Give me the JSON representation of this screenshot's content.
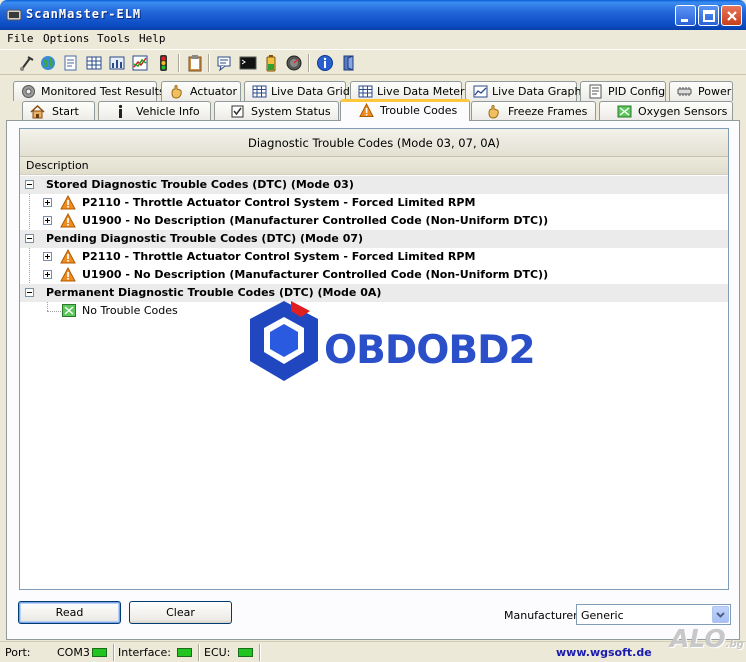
{
  "window": {
    "title": "ScanMaster-ELM"
  },
  "menu": [
    "File",
    "Options",
    "Tools",
    "Help"
  ],
  "toolbar_icons": [
    "connect-icon",
    "globe-icon",
    "document-icon",
    "grid-icon",
    "meter-icon",
    "graph-icon",
    "traffic-light-icon",
    "clipboard-icon",
    "chat-icon",
    "terminal-icon",
    "battery-icon",
    "gauge-icon",
    "info-icon",
    "exit-icon"
  ],
  "tabs_row1": [
    {
      "label": "Monitored Test Results",
      "icon": "gear-icon"
    },
    {
      "label": "Actuator",
      "icon": "hand-icon"
    },
    {
      "label": "Live Data Grid",
      "icon": "grid-icon"
    },
    {
      "label": "Live Data Meter",
      "icon": "meter-icon"
    },
    {
      "label": "Live Data Graph",
      "icon": "graph-icon"
    },
    {
      "label": "PID Config",
      "icon": "config-icon"
    },
    {
      "label": "Power",
      "icon": "power-icon"
    }
  ],
  "tabs_row2": [
    {
      "label": "Start",
      "icon": "home-icon"
    },
    {
      "label": "Vehicle Info",
      "icon": "info-icon"
    },
    {
      "label": "System Status",
      "icon": "checklist-icon"
    },
    {
      "label": "Trouble Codes",
      "icon": "warning-icon",
      "active": true
    },
    {
      "label": "Freeze Frames",
      "icon": "hand-icon"
    },
    {
      "label": "Oxygen Sensors",
      "icon": "sensor-icon"
    }
  ],
  "panel": {
    "header": "Diagnostic Trouble Codes (Mode 03, 07, 0A)",
    "column": "Description",
    "groups": [
      {
        "label": "Stored Diagnostic Trouble Codes (DTC) (Mode 03)",
        "items": [
          "P2110 - Throttle Actuator Control System - Forced Limited RPM",
          "U1900 - No Description (Manufacturer Controlled Code (Non-Uniform DTC))"
        ]
      },
      {
        "label": "Pending Diagnostic Trouble Codes (DTC) (Mode 07)",
        "items": [
          "P2110 - Throttle Actuator Control System - Forced Limited RPM",
          "U1900 - No Description (Manufacturer Controlled Code (Non-Uniform DTC))"
        ]
      },
      {
        "label": "Permanent Diagnostic Trouble Codes (DTC) (Mode 0A)",
        "items": [
          "No Trouble Codes"
        ]
      }
    ],
    "logo_text": "OBDOBD2"
  },
  "buttons": {
    "read": "Read",
    "clear": "Clear"
  },
  "manufacturer": {
    "label": "Manufacturer",
    "value": "Generic"
  },
  "status": {
    "port_label": "Port:",
    "port_value": "COM3",
    "interface_label": "Interface:",
    "ecu_label": "ECU:",
    "led_color": "#22c422",
    "link": "www.wgsoft.de"
  },
  "watermark": "ALO",
  "watermark_suffix": ".bg"
}
